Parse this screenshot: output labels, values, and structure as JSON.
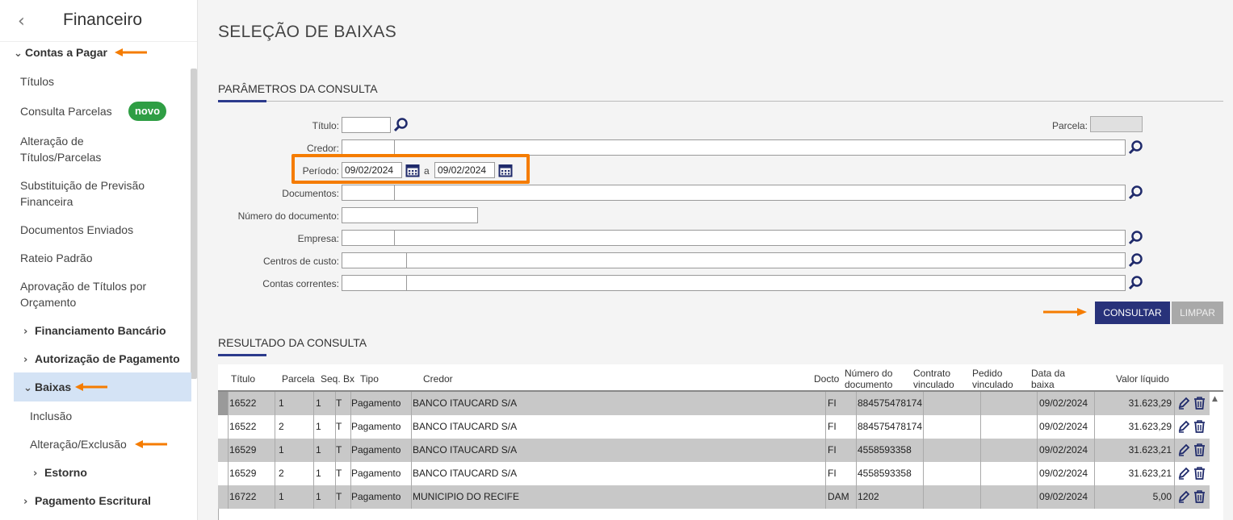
{
  "sidebar": {
    "title": "Financeiro",
    "items": [
      {
        "label": "Contas a Pagar"
      },
      {
        "label": "Títulos"
      },
      {
        "label": "Consulta Parcelas"
      },
      {
        "label": "Alteração de"
      },
      {
        "label": "Títulos/Parcelas"
      },
      {
        "label": "Substituição de Previsão"
      },
      {
        "label": "Financeira"
      },
      {
        "label": "Documentos Enviados"
      },
      {
        "label": "Rateio Padrão"
      },
      {
        "label": "Aprovação de Títulos por"
      },
      {
        "label": "Orçamento"
      },
      {
        "label": "Financiamento Bancário"
      },
      {
        "label": "Autorização de Pagamento"
      },
      {
        "label": "Baixas"
      },
      {
        "label": "Inclusão"
      },
      {
        "label": "Alteração/Exclusão"
      },
      {
        "label": "Estorno"
      },
      {
        "label": "Pagamento Escritural"
      }
    ],
    "badge": "novo"
  },
  "page": {
    "title": "SELEÇÃO DE BAIXAS"
  },
  "params": {
    "section_title": "PARÂMETROS DA CONSULTA",
    "titulo_label": "Título:",
    "titulo_value": "",
    "parcela_label": "Parcela:",
    "credor_label": "Credor:",
    "periodo_label": "Período:",
    "periodo_from": "09/02/2024",
    "periodo_sep": "a",
    "periodo_to": "09/02/2024",
    "documentos_label": "Documentos:",
    "numero_doc_label": "Número do documento:",
    "empresa_label": "Empresa:",
    "centros_label": "Centros de custo:",
    "contas_label": "Contas correntes:",
    "consultar_label": "CONSULTAR",
    "limpar_label": "LIMPAR"
  },
  "results": {
    "section_title": "RESULTADO DA CONSULTA",
    "headers": {
      "titulo": "Título",
      "parcela": "Parcela",
      "seq": "Seq.",
      "bx": "Bx",
      "tipo": "Tipo",
      "credor": "Credor",
      "docto": "Docto",
      "numero_doc_1": "Número do",
      "numero_doc_2": "documento",
      "contrato_1": "Contrato",
      "contrato_2": "vinculado",
      "pedido_1": "Pedido",
      "pedido_2": "vinculado",
      "data_1": "Data da",
      "data_2": "baixa",
      "valor": "Valor líquido"
    },
    "rows": [
      {
        "titulo": "16522",
        "parcela": "1",
        "seq": "1",
        "bx": "T",
        "tipo": "Pagamento",
        "credor": "BANCO ITAUCARD S/A",
        "docto": "FI",
        "numero": "884575478174",
        "contrato": "",
        "pedido": "",
        "data": "09/02/2024",
        "valor": "31.623,29"
      },
      {
        "titulo": "16522",
        "parcela": "2",
        "seq": "1",
        "bx": "T",
        "tipo": "Pagamento",
        "credor": "BANCO ITAUCARD S/A",
        "docto": "FI",
        "numero": "884575478174",
        "contrato": "",
        "pedido": "",
        "data": "09/02/2024",
        "valor": "31.623,29"
      },
      {
        "titulo": "16529",
        "parcela": "1",
        "seq": "1",
        "bx": "T",
        "tipo": "Pagamento",
        "credor": "BANCO ITAUCARD S/A",
        "docto": "FI",
        "numero": "4558593358",
        "contrato": "",
        "pedido": "",
        "data": "09/02/2024",
        "valor": "31.623,21"
      },
      {
        "titulo": "16529",
        "parcela": "2",
        "seq": "1",
        "bx": "T",
        "tipo": "Pagamento",
        "credor": "BANCO ITAUCARD S/A",
        "docto": "FI",
        "numero": "4558593358",
        "contrato": "",
        "pedido": "",
        "data": "09/02/2024",
        "valor": "31.623,21"
      },
      {
        "titulo": "16722",
        "parcela": "1",
        "seq": "1",
        "bx": "T",
        "tipo": "Pagamento",
        "credor": "MUNICIPIO DO RECIFE",
        "docto": "DAM",
        "numero": "1202",
        "contrato": "",
        "pedido": "",
        "data": "09/02/2024",
        "valor": "5,00"
      }
    ]
  },
  "colors": {
    "accent": "#28327a",
    "highlight": "#f57c00",
    "badge": "#2f9e44"
  },
  "icons": [
    "chevron-left-icon",
    "chevron-down-icon",
    "chevron-right-icon",
    "search-icon",
    "calendar-icon",
    "pencil-icon",
    "trash-icon",
    "arrow-annotation-icon"
  ]
}
